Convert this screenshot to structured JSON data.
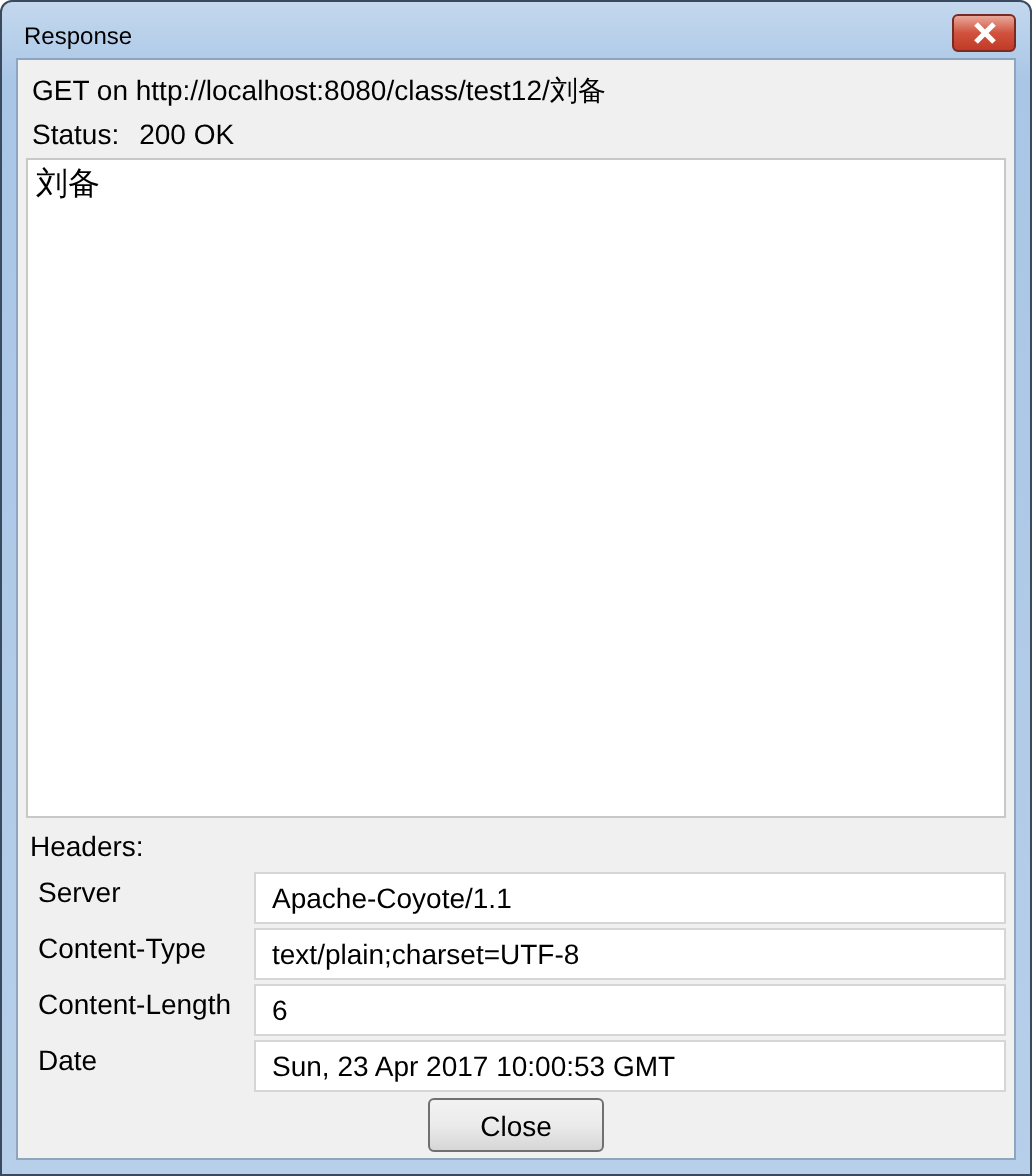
{
  "window": {
    "title": "Response"
  },
  "request_line": "GET on http://localhost:8080/class/test12/刘备",
  "status": {
    "label": "Status:",
    "value": "200 OK"
  },
  "body": "刘备",
  "headers": {
    "label": "Headers:",
    "rows": [
      {
        "name": "Server",
        "value": "Apache-Coyote/1.1"
      },
      {
        "name": "Content-Type",
        "value": "text/plain;charset=UTF-8"
      },
      {
        "name": "Content-Length",
        "value": "6"
      },
      {
        "name": "Date",
        "value": "Sun, 23 Apr 2017 10:00:53 GMT"
      }
    ]
  },
  "buttons": [
    "Close"
  ]
}
